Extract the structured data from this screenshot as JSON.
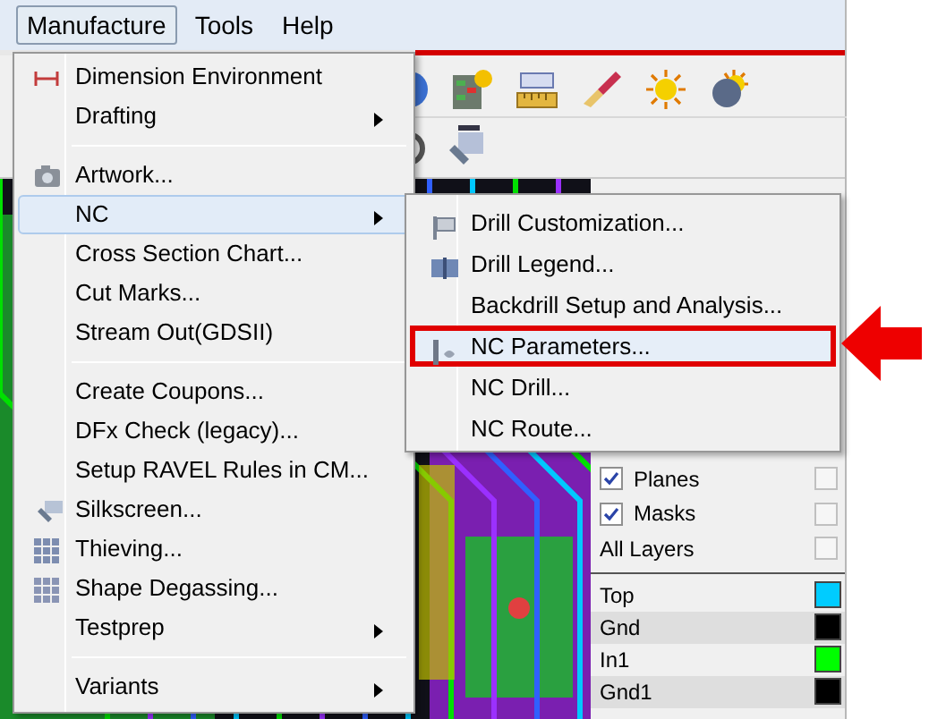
{
  "menu_bar": [
    {
      "label": "Manufacture",
      "selected": true
    },
    {
      "label": "Tools",
      "selected": false
    },
    {
      "label": "Help",
      "selected": false
    }
  ],
  "menu": {
    "items": [
      {
        "kind": "item",
        "label": "Dimension Environment",
        "selected": false
      },
      {
        "kind": "submenu",
        "label": "Drafting",
        "selected": false
      },
      {
        "kind": "separator"
      },
      {
        "kind": "item",
        "label": "Artwork...",
        "selected": false
      },
      {
        "kind": "submenu",
        "label": "NC",
        "selected": true
      },
      {
        "kind": "item",
        "label": "Cross Section Chart...",
        "selected": false
      },
      {
        "kind": "item",
        "label": "Cut Marks...",
        "selected": false
      },
      {
        "kind": "item",
        "label": "Stream Out(GDSII)",
        "selected": false
      },
      {
        "kind": "separator"
      },
      {
        "kind": "item",
        "label": "Create Coupons...",
        "selected": false
      },
      {
        "kind": "item",
        "label": "DFx Check (legacy)...",
        "selected": false
      },
      {
        "kind": "item",
        "label": "Setup RAVEL Rules in CM...",
        "selected": false
      },
      {
        "kind": "item",
        "label": "Silkscreen...",
        "selected": false
      },
      {
        "kind": "item",
        "label": "Thieving...",
        "selected": false
      },
      {
        "kind": "item",
        "label": "Shape Degassing...",
        "selected": false
      },
      {
        "kind": "submenu",
        "label": "Testprep",
        "selected": false
      },
      {
        "kind": "separator"
      },
      {
        "kind": "submenu",
        "label": "Variants",
        "selected": false
      }
    ]
  },
  "submenu": {
    "items": [
      {
        "label": "Drill Customization...",
        "selected": false
      },
      {
        "label": "Drill Legend...",
        "selected": false
      },
      {
        "label": "Backdrill Setup and Analysis...",
        "selected": false
      },
      {
        "label": "NC Parameters...",
        "selected": true
      },
      {
        "label": "NC Drill...",
        "selected": false
      },
      {
        "label": "NC Route...",
        "selected": false
      }
    ]
  },
  "layers_panel": {
    "filters": [
      {
        "kind": "check",
        "label": "Planes",
        "checked": true,
        "all_checked": false
      },
      {
        "kind": "check",
        "label": "Masks",
        "checked": true,
        "all_checked": false
      },
      {
        "kind": "plain",
        "label": "All Layers",
        "all_checked": false
      }
    ],
    "layers": [
      {
        "name": "Top",
        "color": "#00ccff"
      },
      {
        "name": "Gnd",
        "color": "#000000"
      },
      {
        "name": "In1",
        "color": "#00ff00"
      },
      {
        "name": "Gnd1",
        "color": "#000000"
      }
    ]
  }
}
